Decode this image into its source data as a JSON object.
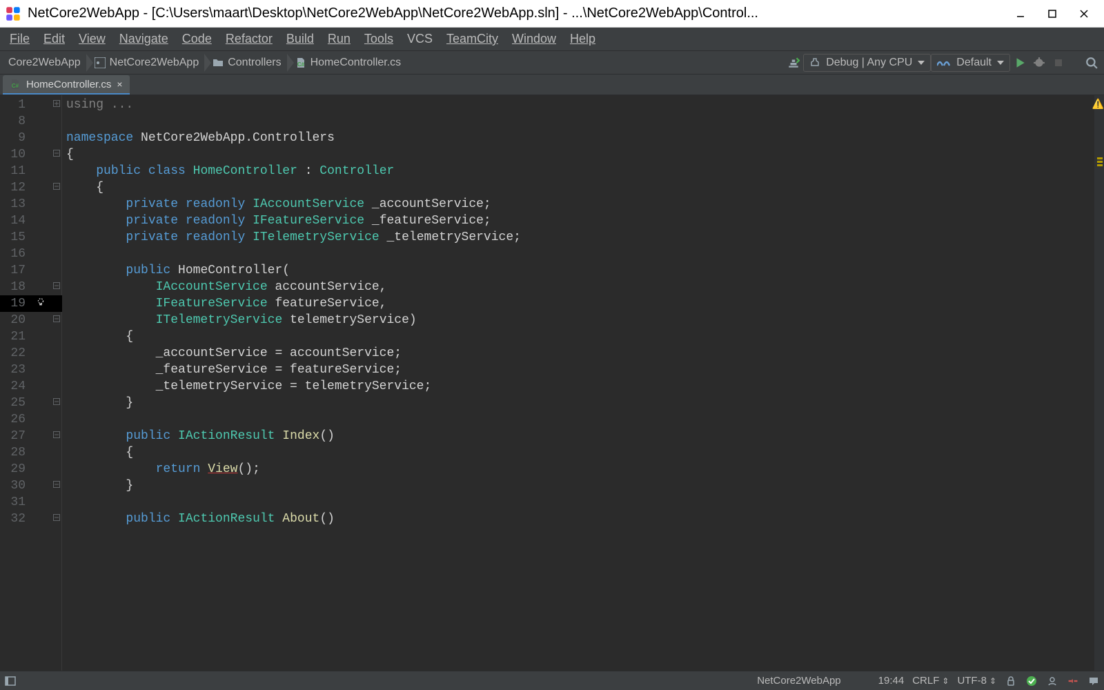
{
  "titlebar": {
    "text": "NetCore2WebApp - [C:\\Users\\maart\\Desktop\\NetCore2WebApp\\NetCore2WebApp.sln] - ...\\NetCore2WebApp\\Control..."
  },
  "menu": {
    "file": "File",
    "edit": "Edit",
    "view": "View",
    "navigate": "Navigate",
    "code": "Code",
    "refactor": "Refactor",
    "build": "Build",
    "run": "Run",
    "tools": "Tools",
    "vcs": "VCS",
    "teamcity": "TeamCity",
    "window": "Window",
    "help": "Help"
  },
  "breadcrumbs": {
    "b0": "Core2WebApp",
    "b1": "NetCore2WebApp",
    "b2": "Controllers",
    "b3": "HomeController.cs"
  },
  "runconfig": {
    "config": "Debug | Any CPU",
    "target": "Default"
  },
  "tab": {
    "name": "HomeController.cs",
    "close": "×"
  },
  "code_lines": [
    {
      "n": 1,
      "tokens": [
        [
          "mut",
          "using "
        ],
        [
          "mut",
          "..."
        ]
      ],
      "fold": "⊞"
    },
    {
      "n": 8,
      "tokens": []
    },
    {
      "n": 9,
      "tokens": [
        [
          "kw",
          "namespace"
        ],
        [
          "pln",
          " NetCore2WebApp.Controllers"
        ]
      ]
    },
    {
      "n": 10,
      "tokens": [
        [
          "pln",
          "{"
        ]
      ],
      "fold": "⊟"
    },
    {
      "n": 11,
      "tokens": [
        [
          "pln",
          "    "
        ],
        [
          "kw",
          "public class"
        ],
        [
          "pln",
          " "
        ],
        [
          "typ",
          "HomeController"
        ],
        [
          "pln",
          " : "
        ],
        [
          "typ",
          "Controller"
        ]
      ]
    },
    {
      "n": 12,
      "tokens": [
        [
          "pln",
          "    {"
        ]
      ],
      "fold": "⊟"
    },
    {
      "n": 13,
      "tokens": [
        [
          "pln",
          "        "
        ],
        [
          "kw",
          "private readonly"
        ],
        [
          "pln",
          " "
        ],
        [
          "typ",
          "IAccountService"
        ],
        [
          "pln",
          " _accountService;"
        ]
      ]
    },
    {
      "n": 14,
      "tokens": [
        [
          "pln",
          "        "
        ],
        [
          "kw",
          "private readonly"
        ],
        [
          "pln",
          " "
        ],
        [
          "typ",
          "IFeatureService"
        ],
        [
          "pln",
          " _featureService;"
        ]
      ]
    },
    {
      "n": 15,
      "tokens": [
        [
          "pln",
          "        "
        ],
        [
          "kw",
          "private readonly"
        ],
        [
          "pln",
          " "
        ],
        [
          "typ",
          "ITelemetryService"
        ],
        [
          "pln",
          " _telemetryService;"
        ]
      ]
    },
    {
      "n": 16,
      "tokens": []
    },
    {
      "n": 17,
      "tokens": [
        [
          "pln",
          "        "
        ],
        [
          "kw",
          "public"
        ],
        [
          "pln",
          " HomeController("
        ]
      ]
    },
    {
      "n": 18,
      "tokens": [
        [
          "pln",
          "            "
        ],
        [
          "typ",
          "IAccountService"
        ],
        [
          "pln",
          " accountService,"
        ]
      ],
      "fold": "⊟"
    },
    {
      "n": 19,
      "tokens": [
        [
          "pln",
          "            "
        ],
        [
          "typ",
          "IFeatureService"
        ],
        [
          "pln",
          " featureService,"
        ]
      ],
      "hint": true,
      "highlight": true
    },
    {
      "n": 20,
      "tokens": [
        [
          "pln",
          "            "
        ],
        [
          "typ",
          "ITelemetryService"
        ],
        [
          "pln",
          " telemetryService)"
        ]
      ],
      "fold": "⊟"
    },
    {
      "n": 21,
      "tokens": [
        [
          "pln",
          "        {"
        ]
      ]
    },
    {
      "n": 22,
      "tokens": [
        [
          "pln",
          "            _accountService = accountService;"
        ]
      ]
    },
    {
      "n": 23,
      "tokens": [
        [
          "pln",
          "            _featureService = featureService;"
        ]
      ]
    },
    {
      "n": 24,
      "tokens": [
        [
          "pln",
          "            _telemetryService = telemetryService;"
        ]
      ]
    },
    {
      "n": 25,
      "tokens": [
        [
          "pln",
          "        }"
        ]
      ],
      "fold": "⊟"
    },
    {
      "n": 26,
      "tokens": []
    },
    {
      "n": 27,
      "tokens": [
        [
          "pln",
          "        "
        ],
        [
          "kw",
          "public"
        ],
        [
          "pln",
          " "
        ],
        [
          "typ",
          "IActionResult"
        ],
        [
          "pln",
          " "
        ],
        [
          "mth",
          "Index"
        ],
        [
          "pln",
          "()"
        ]
      ],
      "fold": "⊟"
    },
    {
      "n": 28,
      "tokens": [
        [
          "pln",
          "        {"
        ]
      ]
    },
    {
      "n": 29,
      "tokens": [
        [
          "pln",
          "            "
        ],
        [
          "kw",
          "return"
        ],
        [
          "pln",
          " "
        ],
        [
          "mth underline",
          "View"
        ],
        [
          "pln",
          "();"
        ]
      ]
    },
    {
      "n": 30,
      "tokens": [
        [
          "pln",
          "        }"
        ]
      ],
      "fold": "⊟"
    },
    {
      "n": 31,
      "tokens": []
    },
    {
      "n": 32,
      "tokens": [
        [
          "pln",
          "        "
        ],
        [
          "kw",
          "public"
        ],
        [
          "pln",
          " "
        ],
        [
          "typ",
          "IActionResult"
        ],
        [
          "pln",
          " "
        ],
        [
          "mth",
          "About"
        ],
        [
          "pln",
          "()"
        ]
      ],
      "fold": "⊟"
    }
  ],
  "statusbar": {
    "project": "NetCore2WebApp",
    "time": "19:44",
    "lineend": "CRLF",
    "encoding": "UTF-8"
  }
}
